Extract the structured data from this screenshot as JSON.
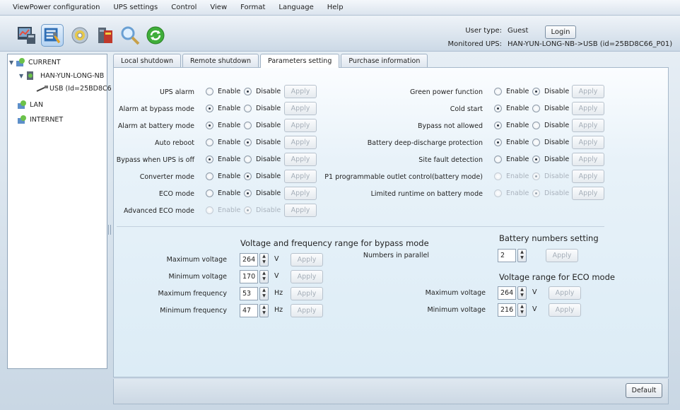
{
  "menu": [
    "ViewPower configuration",
    "UPS settings",
    "Control",
    "View",
    "Format",
    "Language",
    "Help"
  ],
  "toolbar": {
    "icons": [
      "monitor-icon",
      "settings-tools-icon",
      "cd-icon",
      "ups-icon",
      "search-icon",
      "refresh-icon"
    ]
  },
  "user": {
    "type_label": "User type:",
    "type_value": "Guest",
    "login_label": "Login",
    "monitored_label": "Monitored UPS:",
    "monitored_value": "HAN-YUN-LONG-NB->USB (id=25BD8C66_P01)"
  },
  "tree": {
    "current": "CURRENT",
    "host": "HAN-YUN-LONG-NB",
    "usb": "USB (Id=25BD8C6",
    "lan": "LAN",
    "internet": "INTERNET"
  },
  "tabs": [
    "Local shutdown",
    "Remote shutdown",
    "Parameters setting",
    "Purchase information"
  ],
  "common": {
    "enable": "Enable",
    "disable": "Disable",
    "apply": "Apply"
  },
  "left_settings": [
    {
      "label": "UPS alarm",
      "value": "Disable",
      "disabled": false
    },
    {
      "label": "Alarm at bypass mode",
      "value": "Enable",
      "disabled": false
    },
    {
      "label": "Alarm at battery mode",
      "value": "Enable",
      "disabled": false
    },
    {
      "label": "Auto reboot",
      "value": "Disable",
      "disabled": false
    },
    {
      "label": "Bypass when UPS is off",
      "value": "Enable",
      "disabled": false
    },
    {
      "label": "Converter mode",
      "value": "Disable",
      "disabled": false
    },
    {
      "label": "ECO mode",
      "value": "Disable",
      "disabled": false
    },
    {
      "label": "Advanced ECO mode",
      "value": "Disable",
      "disabled": true
    }
  ],
  "right_settings": [
    {
      "label": "Green power function",
      "value": "Disable",
      "disabled": false
    },
    {
      "label": "Cold start",
      "value": "Enable",
      "disabled": false
    },
    {
      "label": "Bypass not allowed",
      "value": "Enable",
      "disabled": false
    },
    {
      "label": "Battery deep-discharge protection",
      "value": "Enable",
      "disabled": false
    },
    {
      "label": "Site fault detection",
      "value": "Disable",
      "disabled": false
    },
    {
      "label": "P1 programmable outlet control(battery mode)",
      "value": "Disable",
      "disabled": true
    },
    {
      "label": "Limited runtime on battery mode",
      "value": "Disable",
      "disabled": true
    }
  ],
  "bypass": {
    "title": "Voltage and frequency range for bypass mode",
    "rows": [
      {
        "label": "Maximum voltage",
        "value": "264",
        "unit": "V"
      },
      {
        "label": "Minimum voltage",
        "value": "170",
        "unit": "V"
      },
      {
        "label": "Maximum frequency",
        "value": "53",
        "unit": "Hz"
      },
      {
        "label": "Minimum frequency",
        "value": "47",
        "unit": "Hz"
      }
    ]
  },
  "battery": {
    "title": "Battery numbers setting",
    "label": "Numbers in parallel",
    "value": "2"
  },
  "eco": {
    "title": "Voltage range for ECO mode",
    "rows": [
      {
        "label": "Maximum voltage",
        "value": "264",
        "unit": "V"
      },
      {
        "label": "Minimum voltage",
        "value": "216",
        "unit": "V"
      }
    ]
  },
  "default_label": "Default"
}
